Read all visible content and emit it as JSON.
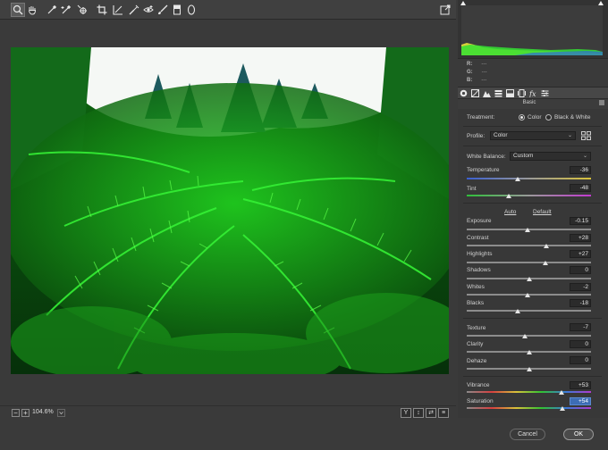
{
  "toolbar": {
    "tools": [
      {
        "name": "zoom-tool",
        "icon": "magnifier-icon",
        "active": true
      },
      {
        "name": "hand-tool",
        "icon": "hand-icon"
      },
      {
        "name": "white-balance-tool",
        "icon": "eyedropper-icon"
      },
      {
        "name": "color-sampler-tool",
        "icon": "eyedropper-plus-icon"
      },
      {
        "name": "targeted-adjustment-tool",
        "icon": "target-adjust-icon"
      },
      {
        "name": "crop-tool",
        "icon": "crop-icon"
      },
      {
        "name": "straighten-tool",
        "icon": "straighten-icon"
      },
      {
        "name": "spot-removal-tool",
        "icon": "spot-removal-icon"
      },
      {
        "name": "red-eye-tool",
        "icon": "red-eye-icon"
      },
      {
        "name": "adjustment-brush-tool",
        "icon": "brush-icon"
      },
      {
        "name": "graduated-filter-tool",
        "icon": "graduated-filter-icon"
      },
      {
        "name": "radial-filter-tool",
        "icon": "radial-filter-icon"
      }
    ],
    "export_icon": "open-export-icon"
  },
  "bottom": {
    "zoom_level": "104.6%",
    "view_buttons": [
      "Y",
      "↕",
      "⇄",
      "≡"
    ]
  },
  "readout": {
    "r_label": "R:",
    "r_value": "---",
    "g_label": "G:",
    "g_value": "---",
    "b_label": "B:",
    "b_value": "---"
  },
  "panel": {
    "title": "Basic",
    "treatment_label": "Treatment:",
    "treatment_color": "Color",
    "treatment_bw": "Black & White",
    "profile_label": "Profile:",
    "profile_value": "Color",
    "wb_label": "White Balance:",
    "wb_value": "Custom",
    "auto_label": "Auto",
    "default_label": "Default",
    "sliders": [
      {
        "key": "temperature",
        "label": "Temperature",
        "value": "-36",
        "pos": 0.41
      },
      {
        "key": "tint",
        "label": "Tint",
        "value": "-48",
        "pos": 0.34
      },
      {
        "key": "exposure",
        "label": "Exposure",
        "value": "-0.15",
        "pos": 0.49
      },
      {
        "key": "contrast",
        "label": "Contrast",
        "value": "+28",
        "pos": 0.64
      },
      {
        "key": "highlights",
        "label": "Highlights",
        "value": "+27",
        "pos": 0.635
      },
      {
        "key": "shadows",
        "label": "Shadows",
        "value": "0",
        "pos": 0.5
      },
      {
        "key": "whites",
        "label": "Whites",
        "value": "-2",
        "pos": 0.49
      },
      {
        "key": "blacks",
        "label": "Blacks",
        "value": "-18",
        "pos": 0.41
      },
      {
        "key": "texture",
        "label": "Texture",
        "value": "-7",
        "pos": 0.465
      },
      {
        "key": "clarity",
        "label": "Clarity",
        "value": "0",
        "pos": 0.5
      },
      {
        "key": "dehaze",
        "label": "Dehaze",
        "value": "0",
        "pos": 0.5
      },
      {
        "key": "vibrance",
        "label": "Vibrance",
        "value": "+53",
        "pos": 0.765
      },
      {
        "key": "saturation",
        "label": "Saturation",
        "value": "+54",
        "pos": 0.77
      }
    ]
  },
  "footer": {
    "cancel_label": "Cancel",
    "ok_label": "OK"
  },
  "colors": {
    "accent": "#3d6db5",
    "temperature_left": "#3a5fd0",
    "temperature_right": "#d8c23a",
    "tint_left": "#2fbf3a",
    "tint_right": "#c23ad0"
  }
}
